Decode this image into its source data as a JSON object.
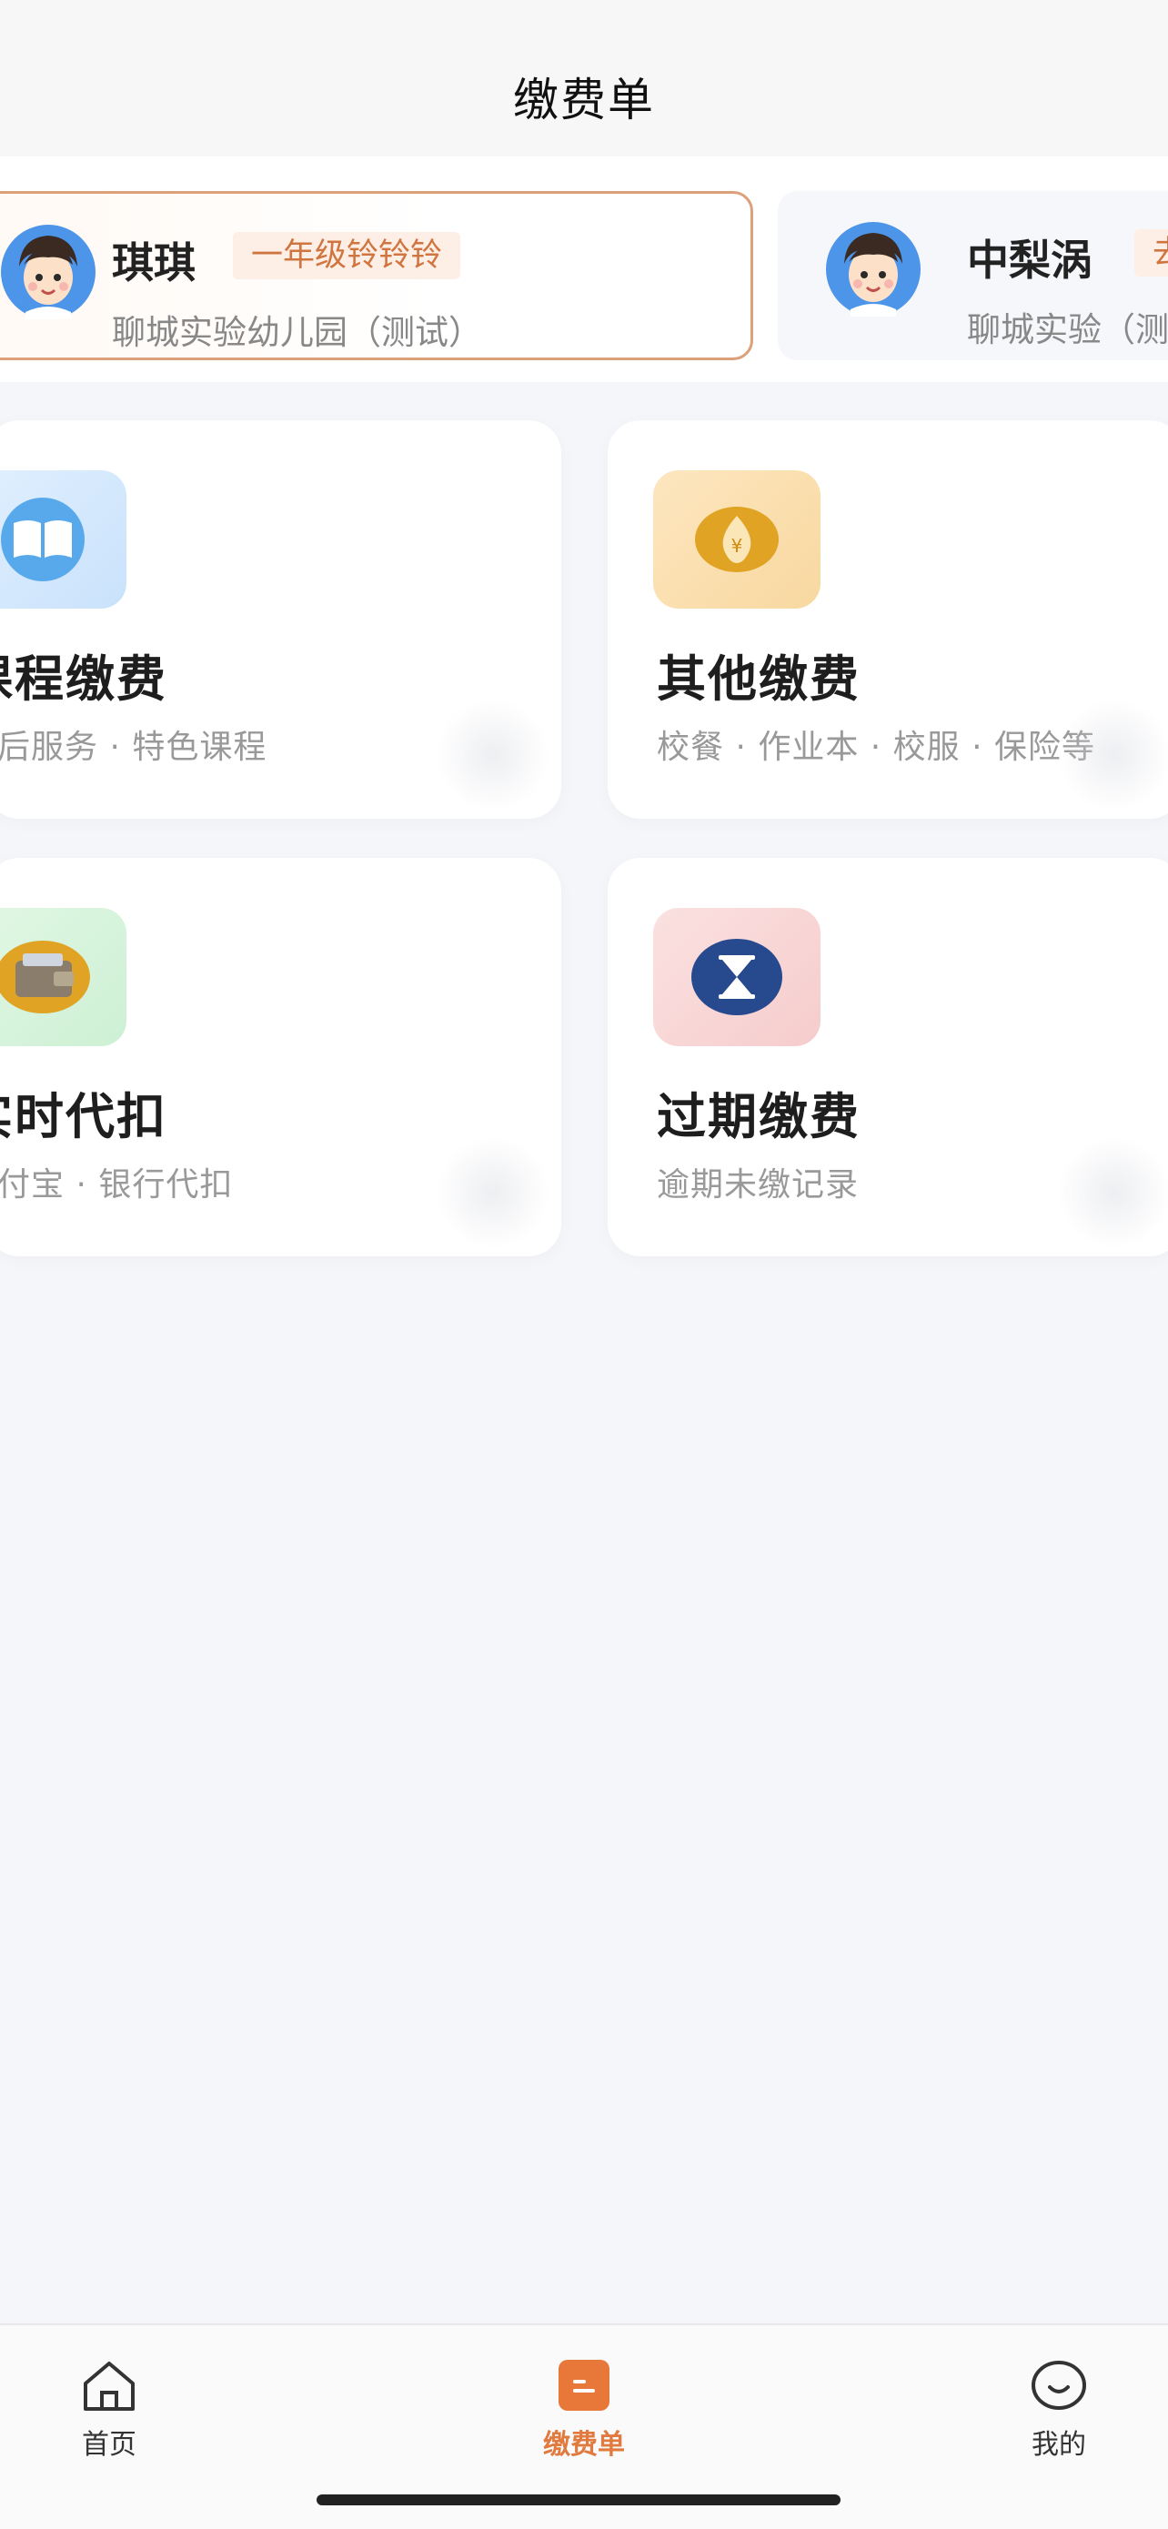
{
  "header": {
    "title": "缴费单"
  },
  "students": [
    {
      "name": "琪琪",
      "grade": "一年级铃铃铃",
      "school": "聊城实验幼儿园（测试）",
      "selected": true
    },
    {
      "name": "中梨涡",
      "grade": "去",
      "school": "聊城实验（测",
      "selected": false
    }
  ],
  "cards": {
    "course": {
      "title": "课程缴费",
      "subtitle": "课后服务 · 特色课程",
      "icon": "book-icon"
    },
    "other": {
      "title": "其他缴费",
      "subtitle": "校餐 · 作业本 · 校服 · 保险等",
      "icon": "money-bag-icon"
    },
    "autodebit": {
      "title": "实时代扣",
      "subtitle": "支付宝 · 银行代扣",
      "icon": "wallet-icon"
    },
    "overdue": {
      "title": "过期缴费",
      "subtitle": "逾期未缴记录",
      "icon": "hourglass-icon"
    }
  },
  "tabbar": {
    "items": [
      {
        "label": "首页",
        "icon": "home-icon"
      },
      {
        "label": "缴费单",
        "icon": "bill-icon",
        "active": true
      },
      {
        "label": "我的",
        "icon": "smile-icon"
      }
    ]
  },
  "colors": {
    "accent": "#e07a3e",
    "background": "#f5f6fa",
    "badge_bg": "#fdeee6",
    "selected_border": "#dca07a"
  }
}
